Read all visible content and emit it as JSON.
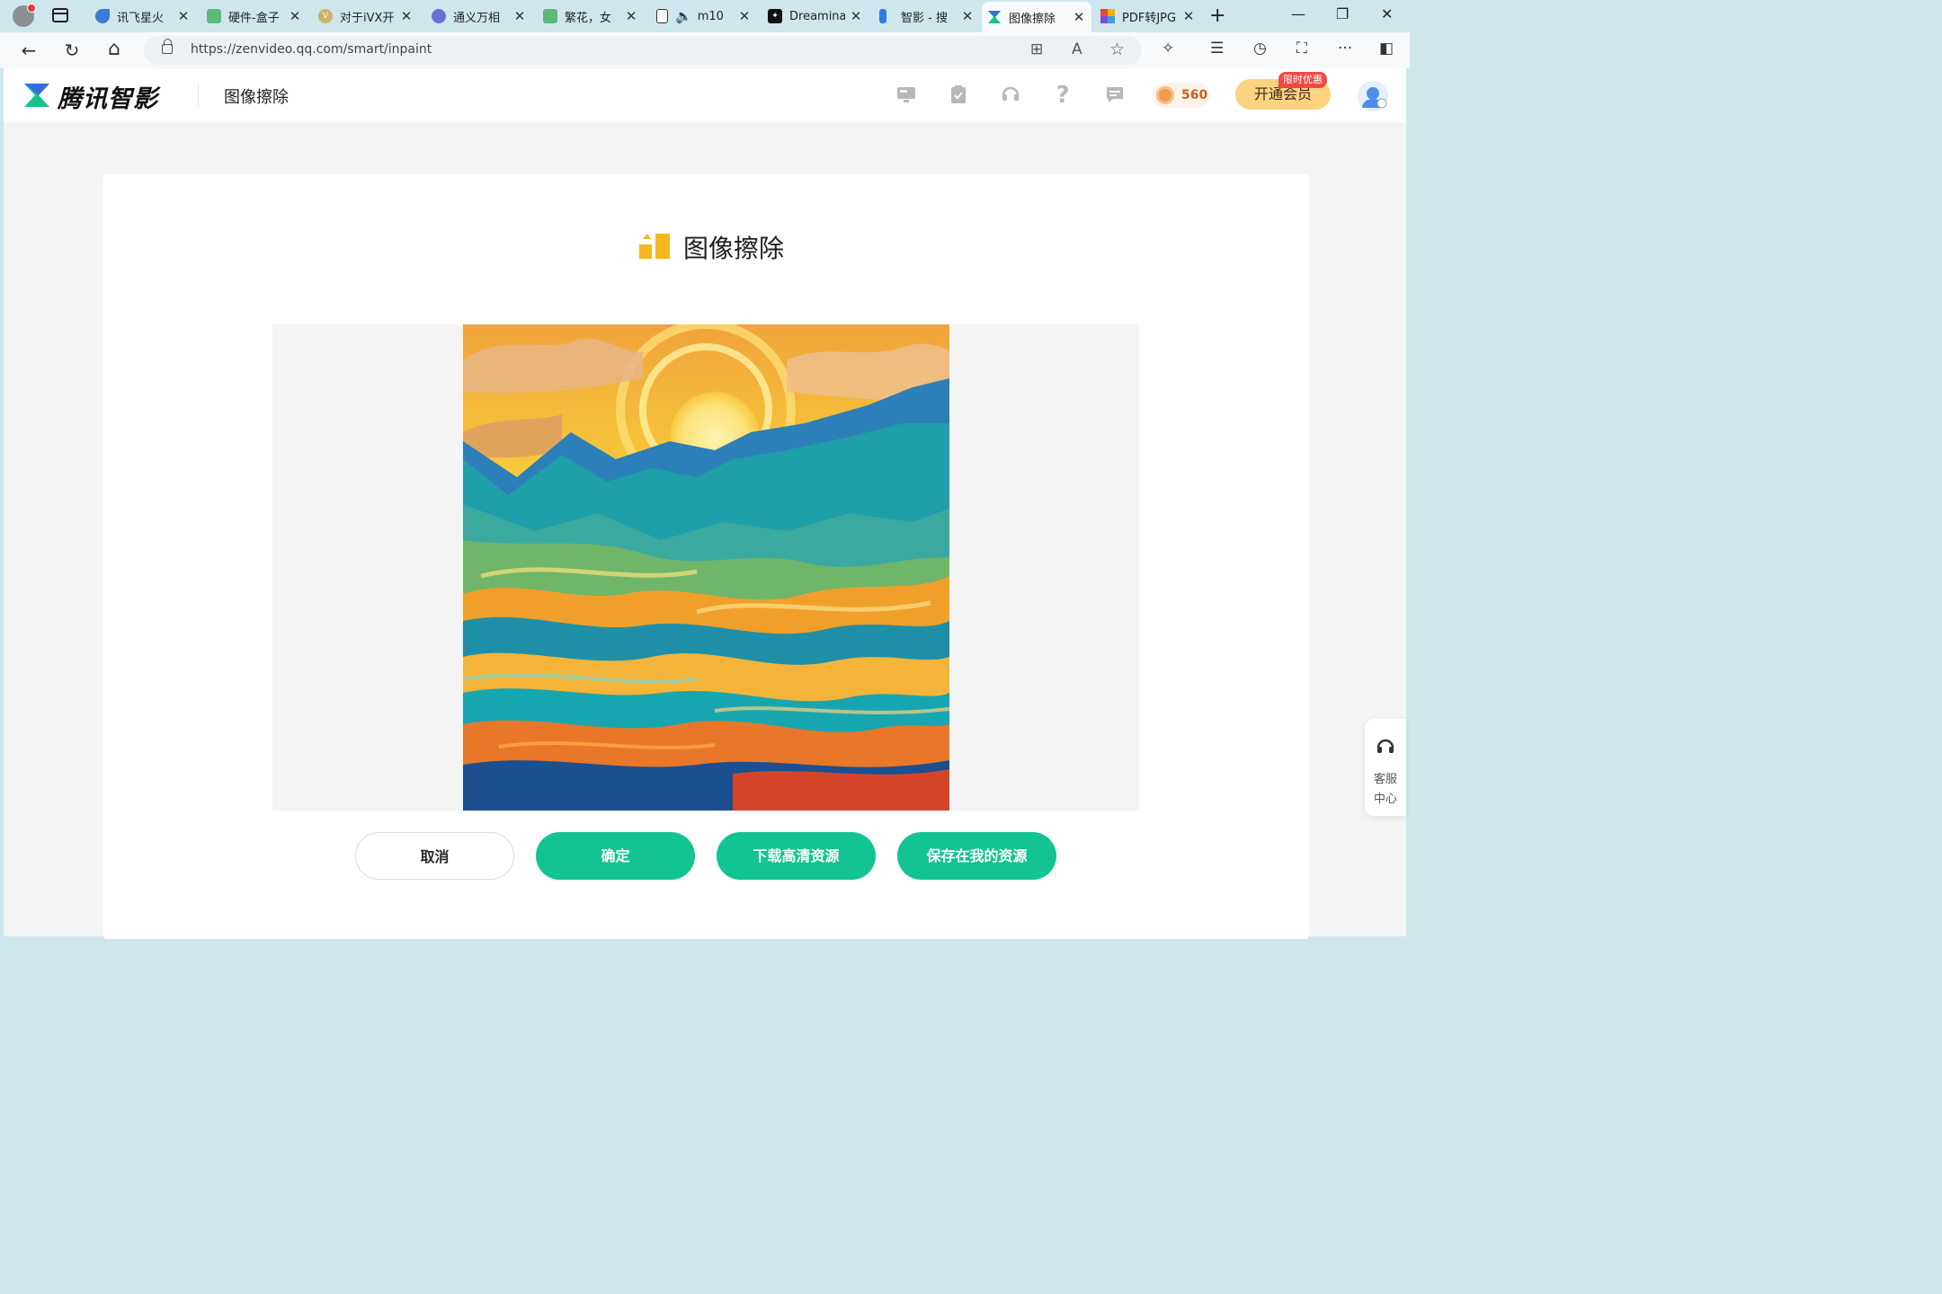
{
  "browser": {
    "tabs": [
      {
        "label": "讯飞星火",
        "favicon_color": "#3a7bd5"
      },
      {
        "label": "硬件-盒子",
        "favicon_color": "#5fb87a"
      },
      {
        "label": "对于iVX开",
        "favicon_color": "#c8b46a"
      },
      {
        "label": "通义万相",
        "favicon_color": "#6b6fd8"
      },
      {
        "label": "繁花，女",
        "favicon_color": "#5fb87a"
      },
      {
        "label": "m10",
        "favicon_color": "#ffffff"
      },
      {
        "label": "Dreamina",
        "favicon_color": "#111111"
      },
      {
        "label": "智影 - 搜",
        "favicon_color": "#2f7de1"
      },
      {
        "label": "图像擦除",
        "favicon_color": "#18c18e"
      },
      {
        "label": "PDF转JPG",
        "favicon_color": "#e04a3a"
      }
    ],
    "tab_close": "✕",
    "new_tab": "+",
    "window": {
      "minimize": "—",
      "restore": "❐",
      "close": "✕"
    },
    "url": "https://zenvideo.qq.com/smart/inpaint",
    "nav": {
      "back": "←",
      "reload": "↻",
      "home": "⌂"
    },
    "omnibox_icons": {
      "apps": "⊞",
      "read_aloud": "A",
      "favorite": "☆"
    },
    "toolbar_icons": {
      "extensions": "✧",
      "favorites": "☰",
      "history": "◷",
      "screenshot": "⛶",
      "more": "···",
      "sidebar": "◧"
    }
  },
  "header": {
    "brand": "腾讯智影",
    "page_title": "图像擦除",
    "icons": [
      "monitor-icon",
      "clipboard-check-icon",
      "headset-icon",
      "help-icon",
      "message-icon"
    ],
    "coins": "560",
    "vip_button": "开通会员",
    "promo_badge": "限时优惠"
  },
  "main": {
    "title": "图像擦除",
    "buttons": {
      "cancel": "取消",
      "confirm": "确定",
      "download": "下载高清资源",
      "save": "保存在我的资源"
    }
  },
  "support": {
    "line1": "客服",
    "line2": "中心"
  },
  "colors": {
    "accent": "#14c392",
    "vip": "#fcd380",
    "promo": "#f04848",
    "title_icon": "#f5b820"
  }
}
